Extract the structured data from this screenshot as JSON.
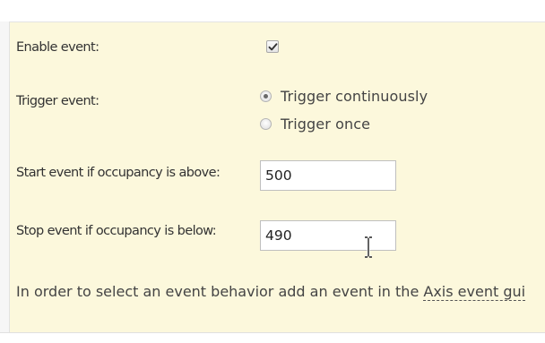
{
  "form": {
    "enable_event_label": "Enable event:",
    "enable_event_checked": true,
    "trigger_event_label": "Trigger event:",
    "trigger_options": [
      {
        "label": "Trigger continuously",
        "selected": true
      },
      {
        "label": "Trigger once",
        "selected": false
      }
    ],
    "start_label": "Start event if occupancy is above:",
    "start_value": "500",
    "stop_label": "Stop event if occupancy is below:",
    "stop_value": "490"
  },
  "footer": {
    "text_before": "In order to select an event behavior add an event in the ",
    "link_text": "Axis event gui"
  },
  "icons": {
    "checkbox": "checkmark-icon",
    "cursor": "text-cursor-icon"
  },
  "colors": {
    "panel_background": "#fcf8dc"
  }
}
